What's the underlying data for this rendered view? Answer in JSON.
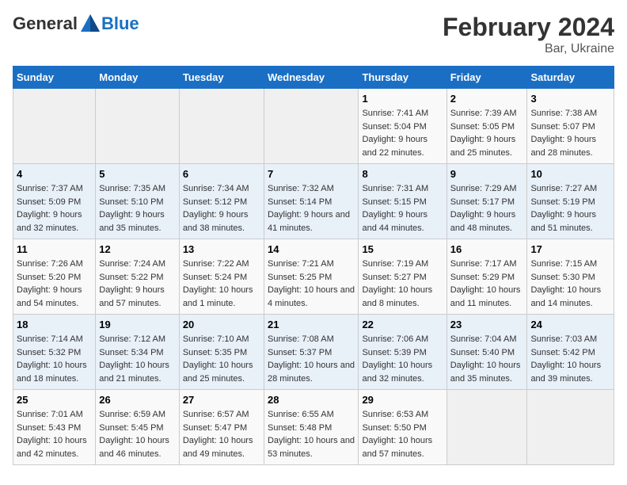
{
  "header": {
    "logo_general": "General",
    "logo_blue": "Blue",
    "title": "February 2024",
    "subtitle": "Bar, Ukraine"
  },
  "weekdays": [
    "Sunday",
    "Monday",
    "Tuesday",
    "Wednesday",
    "Thursday",
    "Friday",
    "Saturday"
  ],
  "weeks": [
    {
      "days": [
        {
          "num": "",
          "info": ""
        },
        {
          "num": "",
          "info": ""
        },
        {
          "num": "",
          "info": ""
        },
        {
          "num": "",
          "info": ""
        },
        {
          "num": "1",
          "info": "Sunrise: 7:41 AM\nSunset: 5:04 PM\nDaylight: 9 hours and 22 minutes."
        },
        {
          "num": "2",
          "info": "Sunrise: 7:39 AM\nSunset: 5:05 PM\nDaylight: 9 hours and 25 minutes."
        },
        {
          "num": "3",
          "info": "Sunrise: 7:38 AM\nSunset: 5:07 PM\nDaylight: 9 hours and 28 minutes."
        }
      ]
    },
    {
      "days": [
        {
          "num": "4",
          "info": "Sunrise: 7:37 AM\nSunset: 5:09 PM\nDaylight: 9 hours and 32 minutes."
        },
        {
          "num": "5",
          "info": "Sunrise: 7:35 AM\nSunset: 5:10 PM\nDaylight: 9 hours and 35 minutes."
        },
        {
          "num": "6",
          "info": "Sunrise: 7:34 AM\nSunset: 5:12 PM\nDaylight: 9 hours and 38 minutes."
        },
        {
          "num": "7",
          "info": "Sunrise: 7:32 AM\nSunset: 5:14 PM\nDaylight: 9 hours and 41 minutes."
        },
        {
          "num": "8",
          "info": "Sunrise: 7:31 AM\nSunset: 5:15 PM\nDaylight: 9 hours and 44 minutes."
        },
        {
          "num": "9",
          "info": "Sunrise: 7:29 AM\nSunset: 5:17 PM\nDaylight: 9 hours and 48 minutes."
        },
        {
          "num": "10",
          "info": "Sunrise: 7:27 AM\nSunset: 5:19 PM\nDaylight: 9 hours and 51 minutes."
        }
      ]
    },
    {
      "days": [
        {
          "num": "11",
          "info": "Sunrise: 7:26 AM\nSunset: 5:20 PM\nDaylight: 9 hours and 54 minutes."
        },
        {
          "num": "12",
          "info": "Sunrise: 7:24 AM\nSunset: 5:22 PM\nDaylight: 9 hours and 57 minutes."
        },
        {
          "num": "13",
          "info": "Sunrise: 7:22 AM\nSunset: 5:24 PM\nDaylight: 10 hours and 1 minute."
        },
        {
          "num": "14",
          "info": "Sunrise: 7:21 AM\nSunset: 5:25 PM\nDaylight: 10 hours and 4 minutes."
        },
        {
          "num": "15",
          "info": "Sunrise: 7:19 AM\nSunset: 5:27 PM\nDaylight: 10 hours and 8 minutes."
        },
        {
          "num": "16",
          "info": "Sunrise: 7:17 AM\nSunset: 5:29 PM\nDaylight: 10 hours and 11 minutes."
        },
        {
          "num": "17",
          "info": "Sunrise: 7:15 AM\nSunset: 5:30 PM\nDaylight: 10 hours and 14 minutes."
        }
      ]
    },
    {
      "days": [
        {
          "num": "18",
          "info": "Sunrise: 7:14 AM\nSunset: 5:32 PM\nDaylight: 10 hours and 18 minutes."
        },
        {
          "num": "19",
          "info": "Sunrise: 7:12 AM\nSunset: 5:34 PM\nDaylight: 10 hours and 21 minutes."
        },
        {
          "num": "20",
          "info": "Sunrise: 7:10 AM\nSunset: 5:35 PM\nDaylight: 10 hours and 25 minutes."
        },
        {
          "num": "21",
          "info": "Sunrise: 7:08 AM\nSunset: 5:37 PM\nDaylight: 10 hours and 28 minutes."
        },
        {
          "num": "22",
          "info": "Sunrise: 7:06 AM\nSunset: 5:39 PM\nDaylight: 10 hours and 32 minutes."
        },
        {
          "num": "23",
          "info": "Sunrise: 7:04 AM\nSunset: 5:40 PM\nDaylight: 10 hours and 35 minutes."
        },
        {
          "num": "24",
          "info": "Sunrise: 7:03 AM\nSunset: 5:42 PM\nDaylight: 10 hours and 39 minutes."
        }
      ]
    },
    {
      "days": [
        {
          "num": "25",
          "info": "Sunrise: 7:01 AM\nSunset: 5:43 PM\nDaylight: 10 hours and 42 minutes."
        },
        {
          "num": "26",
          "info": "Sunrise: 6:59 AM\nSunset: 5:45 PM\nDaylight: 10 hours and 46 minutes."
        },
        {
          "num": "27",
          "info": "Sunrise: 6:57 AM\nSunset: 5:47 PM\nDaylight: 10 hours and 49 minutes."
        },
        {
          "num": "28",
          "info": "Sunrise: 6:55 AM\nSunset: 5:48 PM\nDaylight: 10 hours and 53 minutes."
        },
        {
          "num": "29",
          "info": "Sunrise: 6:53 AM\nSunset: 5:50 PM\nDaylight: 10 hours and 57 minutes."
        },
        {
          "num": "",
          "info": ""
        },
        {
          "num": "",
          "info": ""
        }
      ]
    }
  ]
}
